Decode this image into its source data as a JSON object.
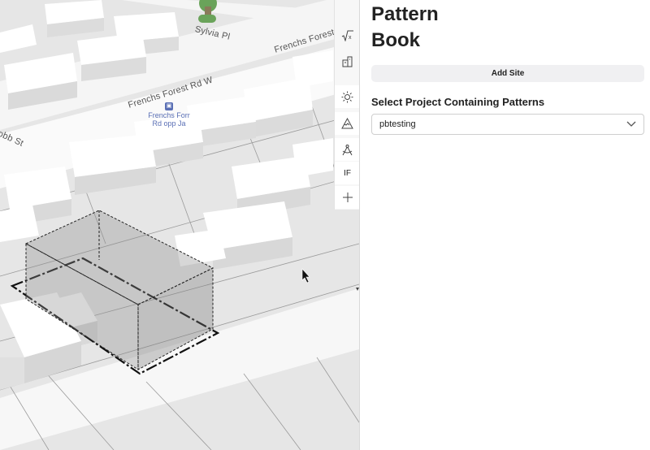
{
  "map": {
    "streets": [
      {
        "name": "Sylvia Pl"
      },
      {
        "name": "Frenchs Forest Rd"
      },
      {
        "name": "Frenchs Forest Rd W"
      },
      {
        "name": "obb St"
      }
    ],
    "poi": {
      "icon": "bus-stop-icon",
      "line1": "Frenchs Forr",
      "line2": "Rd opp Ja"
    }
  },
  "toolbar": {
    "items": [
      {
        "icon": "sqrt-x-icon"
      },
      {
        "icon": "buildings-icon"
      },
      {
        "icon": "sun-icon"
      },
      {
        "icon": "mountain-icon"
      },
      {
        "icon": "compass-icon"
      },
      {
        "label": "IF"
      },
      {
        "icon": "plus-icon"
      }
    ]
  },
  "panel": {
    "title_line1": "Pattern",
    "title_line2": "Book",
    "add_site_label": "Add Site",
    "select_label": "Select Project Containing Patterns",
    "selected_project": "pbtesting"
  }
}
